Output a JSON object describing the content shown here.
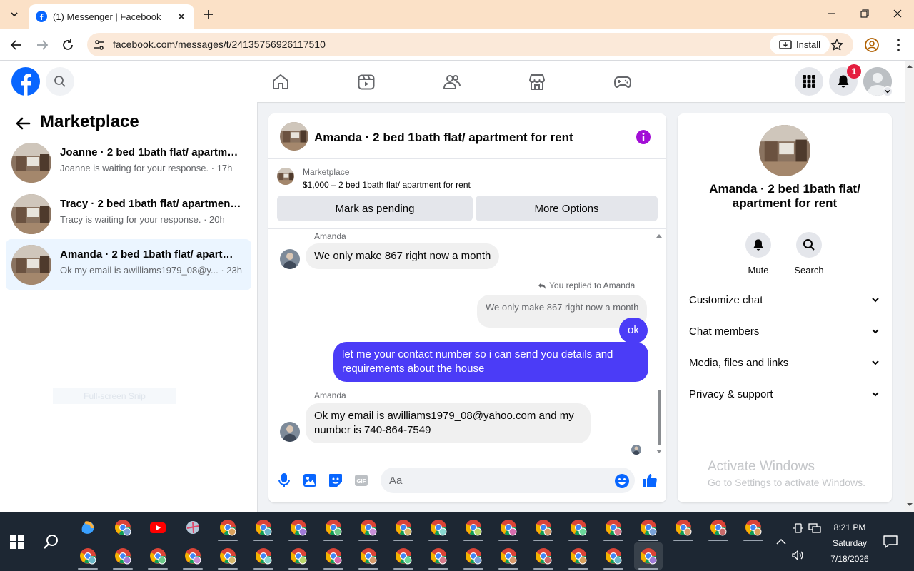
{
  "browser": {
    "tab_title": "(1) Messenger | Facebook",
    "url": "facebook.com/messages/t/24135756926117510",
    "install_label": "Install"
  },
  "fb": {
    "notif_count": "1"
  },
  "sidebar": {
    "title": "Marketplace",
    "conversations": [
      {
        "name": "Joanne · 2 bed 1bath flat/ apartment for rent",
        "snippet": "Joanne is waiting for your response. · 17h"
      },
      {
        "name": "Tracy · 2 bed 1bath flat/ apartment for rent",
        "snippet": "Tracy is waiting for your response. · 20h"
      },
      {
        "name": "Amanda · 2 bed 1bath flat/ apartment for rent",
        "snippet": "Ok my email is awilliams1979_08@y... · 23h"
      }
    ],
    "ghost_text": "Full-screen Snip"
  },
  "chat": {
    "title": "Amanda · 2 bed 1bath flat/ apartment for rent",
    "marketplace_label": "Marketplace",
    "listing": "$1,000 – 2 bed 1bath flat/ apartment for rent",
    "btn_pending": "Mark as pending",
    "btn_more": "More Options",
    "messages": [
      {
        "sender": "Amanda",
        "text": "We only make 867 right now a month"
      },
      {
        "reply_note": "You replied to Amanda",
        "quoted": "We only make 867 right now a month"
      },
      {
        "text": "ok"
      },
      {
        "text": "let me your contact number so i can send you details and requirements about the house"
      },
      {
        "sender": "Amanda",
        "text": "Ok my email is awilliams1979_08@yahoo.com and my number is 740-864-7549"
      }
    ],
    "composer_placeholder": "Aa"
  },
  "right_panel": {
    "name": "Amanda · 2 bed 1bath flat/ apartment for rent",
    "actions": [
      "Mute",
      "Search"
    ],
    "rows": [
      "Customize chat",
      "Chat members",
      "Media, files and links",
      "Privacy & support"
    ]
  },
  "watermark": {
    "line1": "Activate Windows",
    "line2": "Go to Settings to activate Windows."
  },
  "taskbar": {
    "time": "8:21 PM",
    "day": "Saturday",
    "date": "7/18/2026"
  },
  "colors": {
    "fb_blue": "#0866ff",
    "outgoing_bubble": "#4b3cf7",
    "tab_strip": "#fbe1c7",
    "taskbar": "#1d2733"
  }
}
